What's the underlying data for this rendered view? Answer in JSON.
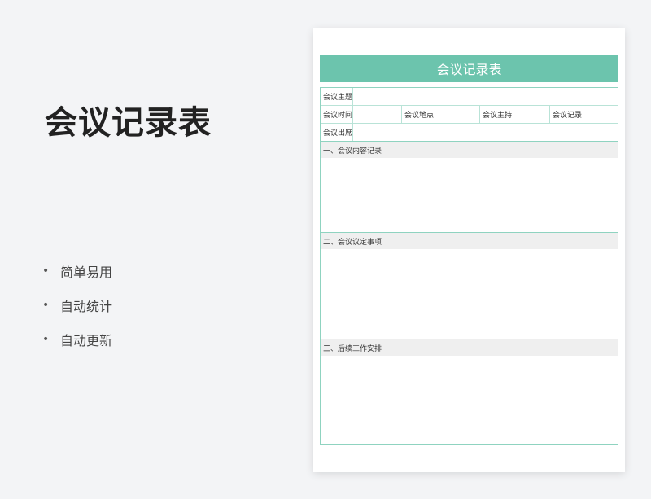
{
  "title": "会议记录表",
  "features": [
    "简单易用",
    "自动统计",
    "自动更新"
  ],
  "bullet": "•",
  "sheet": {
    "header": "会议记录表",
    "fields": {
      "topic": "会议主题",
      "time": "会议时间",
      "place": "会议地点",
      "host": "会议主持",
      "recorder": "会议记录",
      "attendees": "会议出席"
    },
    "sections": [
      "一、会议内容记录",
      "二、会议议定事项",
      "三、后续工作安排"
    ]
  },
  "colors": {
    "accent": "#6cc4ad",
    "border": "#8fd3c0",
    "background": "#f3f4f6"
  }
}
